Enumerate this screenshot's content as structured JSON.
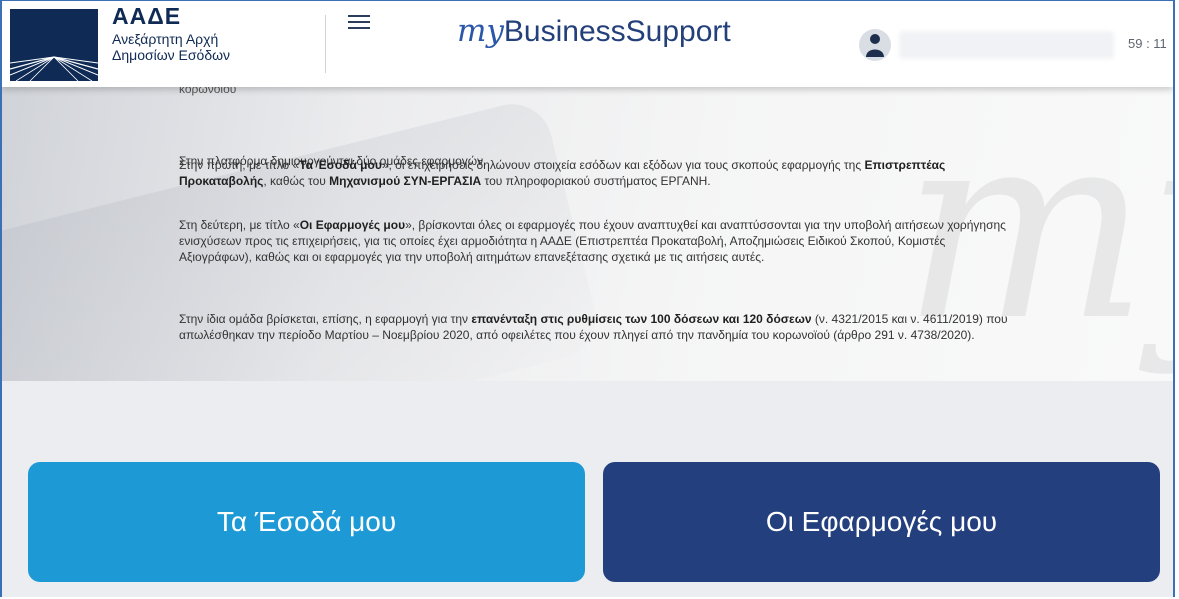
{
  "header": {
    "org_acronym": "ΑΑΔΕ",
    "org_name_line1": "Ανεξάρτητη Αρχή",
    "org_name_line2": "Δημοσίων Εσόδων",
    "brand_prefix": "my",
    "brand_name": "BusinessSupport",
    "timer": "59 : 11",
    "icons": {
      "menu": "hamburger-menu-icon",
      "user": "user-avatar-icon"
    }
  },
  "intro": {
    "p0": "κορωνοϊού",
    "p1": "Στην πλατφόρμα δημιουργούνται δύο ομάδες εφαρμογών.",
    "p2_a": "Στην πρώτη, με τίτλο «",
    "p2_b": "Τα Έσοδά μου",
    "p2_c": "», οι επιχειρήσεις δηλώνουν στοιχεία εσόδων και εξόδων για τους σκοπούς εφαρμογής της ",
    "p2_d": "Επιστρεπτέας Προκαταβολής",
    "p2_e": ", καθώς του ",
    "p2_f": "Μηχανισμού ΣΥΝ-ΕΡΓΑΣΙΑ",
    "p2_g": " του πληροφοριακού συστήματος ΕΡΓΑΝΗ.",
    "p3_a": "Στη δεύτερη, με τίτλο «",
    "p3_b": "Οι Εφαρμογές μου",
    "p3_c": "», βρίσκονται όλες οι εφαρμογές που έχουν αναπτυχθεί και αναπτύσσονται για την υποβολή αιτήσεων χορήγησης ενισχύσεων προς τις επιχειρήσεις, για τις οποίες έχει αρμοδιότητα η ΑΑΔΕ (Επιστρεπτέα Προκαταβολή, Αποζημιώσεις Ειδικού Σκοπού, Κομιστές Αξιογράφων), καθώς και οι εφαρμογές για την υποβολή αιτημάτων επανεξέτασης σχετικά με τις αιτήσεις αυτές.",
    "p4_a": "Στην ίδια ομάδα βρίσκεται, επίσης, η εφαρμογή για την ",
    "p4_b": "επανένταξη στις ρυθμίσεις των 100 δόσεων και 120 δόσεων",
    "p4_c": " (ν. 4321/2015 και ν. 4611/2019) που απωλέσθηκαν την περίοδο Μαρτίου – Νοεμβρίου 2020, από οφειλέτες που έχουν πληγεί από την πανδημία του κορωνοϊού (άρθρο 291 ν. 4738/2020)."
  },
  "cards": {
    "incomes_label": "Τα Έσοδά μου",
    "apps_label": "Οι Εφαρμογές μου"
  },
  "colors": {
    "incomes_card": "#1d9ad6",
    "apps_card": "#243f7d",
    "brand": "#2b57a8",
    "org_navy": "#0f2a55"
  }
}
